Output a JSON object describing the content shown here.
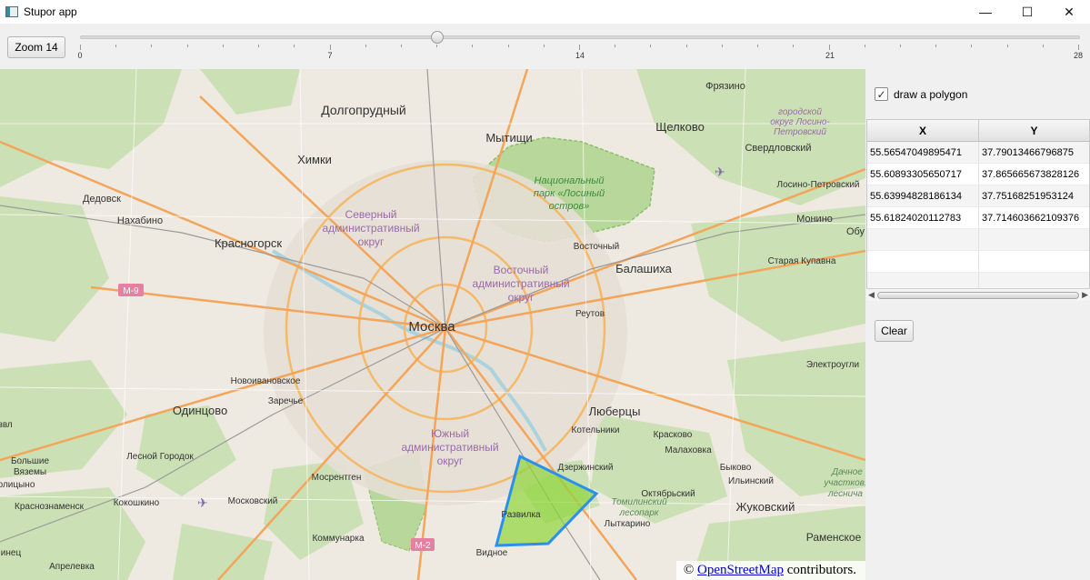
{
  "window": {
    "title": "Stupor app",
    "controls": {
      "minimize": "—",
      "maximize": "☐",
      "close": "✕"
    }
  },
  "toolbar": {
    "zoom_button_label": "Zoom 14",
    "slider": {
      "min": 0,
      "max": 28,
      "value": 14,
      "labels": [
        "0",
        "7",
        "14",
        "21",
        "28"
      ]
    }
  },
  "map": {
    "labels": {
      "dolgoprudny": "Долгопрудный",
      "mytishchi": "Мытищи",
      "shchelkovo": "Щелково",
      "fryazino": "Фрязино",
      "khimki": "Химки",
      "dedovsk": "Дедовск",
      "nakhabino": "Нахабино",
      "krasnogorsk": "Красногорск",
      "severny_1": "Северный",
      "severny_2": "административный",
      "severny_3": "округ",
      "park_1": "Национальный",
      "park_2": "парк «Лосиный",
      "park_3": "остров»",
      "gorodskoy_1": "городской",
      "gorodskoy_2": "округ Лосино-",
      "gorodskoy_3": "Петровский",
      "sverdlovsky": "Свердловский",
      "losino": "Лосино-Петровский",
      "monino": "Монино",
      "obu": "Обу",
      "vostochny": "Восточный",
      "balashikha": "Балашиха",
      "staraya": "Старая Купавна",
      "vost_1": "Восточный",
      "vost_2": "административный",
      "vost_3": "округ",
      "m9": "М-9",
      "moskva": "Москва",
      "reutov": "Реутов",
      "novoivan": "Новоивановское",
      "zarechye": "Заречье",
      "odintsovo": "Одинцово",
      "elektrougli": "Электроугли",
      "lyubertsy": "Люберцы",
      "kotelniki": "Котельники",
      "yuzh_1": "Южный",
      "yuzh_2": "административный",
      "yuzh_3": "округ",
      "lesnoy": "Лесной Городок",
      "bolshie_1": "Большие",
      "bolshie_2": "Вяземы",
      "golitsyno": "олицыно",
      "krasnoznamensk": "Краснознаменск",
      "kokoshkino": "Кокошкино",
      "moskovsky": "Московский",
      "mosrentgen": "Мосрентген",
      "dzerzhinsky": "Дзержинский",
      "kraskovo": "Красково",
      "malakhovka": "Малаховка",
      "bykovo": "Быково",
      "ilinsky": "Ильинский",
      "oktyabrsky": "Октябрьский",
      "tomilinsky_1": "Томилинский",
      "tomilinsky_2": "лесопарк",
      "lytkarino": "Лыткарино",
      "zhukovsky": "Жуковский",
      "ramenskoe": "Раменское",
      "dachnoe_1": "Дачное",
      "dachnoe_2": "участков.",
      "dachnoe_3": "леснича",
      "razvilka": "Развилка",
      "kommunarka": "Коммунарка",
      "m2": "М-2",
      "vidnoe": "Видное",
      "aprelevka": "Апрелевка",
      "nets": "инец",
      "zvl": "звл"
    },
    "attribution": {
      "prefix": "© ",
      "link": "OpenStreetMap",
      "suffix": " contributors."
    },
    "polygon_fill": "#8ed63a",
    "polygon_stroke": "#2a8ff0"
  },
  "panel": {
    "draw_polygon_label": "draw a polygon",
    "draw_polygon_checked": "✓",
    "table": {
      "headers": {
        "x": "X",
        "y": "Y"
      },
      "rows": [
        {
          "x": "55.56547049895471",
          "y": "37.79013466796875"
        },
        {
          "x": "55.60893305650717",
          "y": "37.865665673828126"
        },
        {
          "x": "55.63994828186134",
          "y": "37.75168251953124"
        },
        {
          "x": "55.61824020112783",
          "y": "37.714603662109376"
        },
        {
          "x": "",
          "y": ""
        },
        {
          "x": "",
          "y": ""
        },
        {
          "x": "",
          "y": ""
        }
      ]
    },
    "clear_label": "Clear"
  }
}
